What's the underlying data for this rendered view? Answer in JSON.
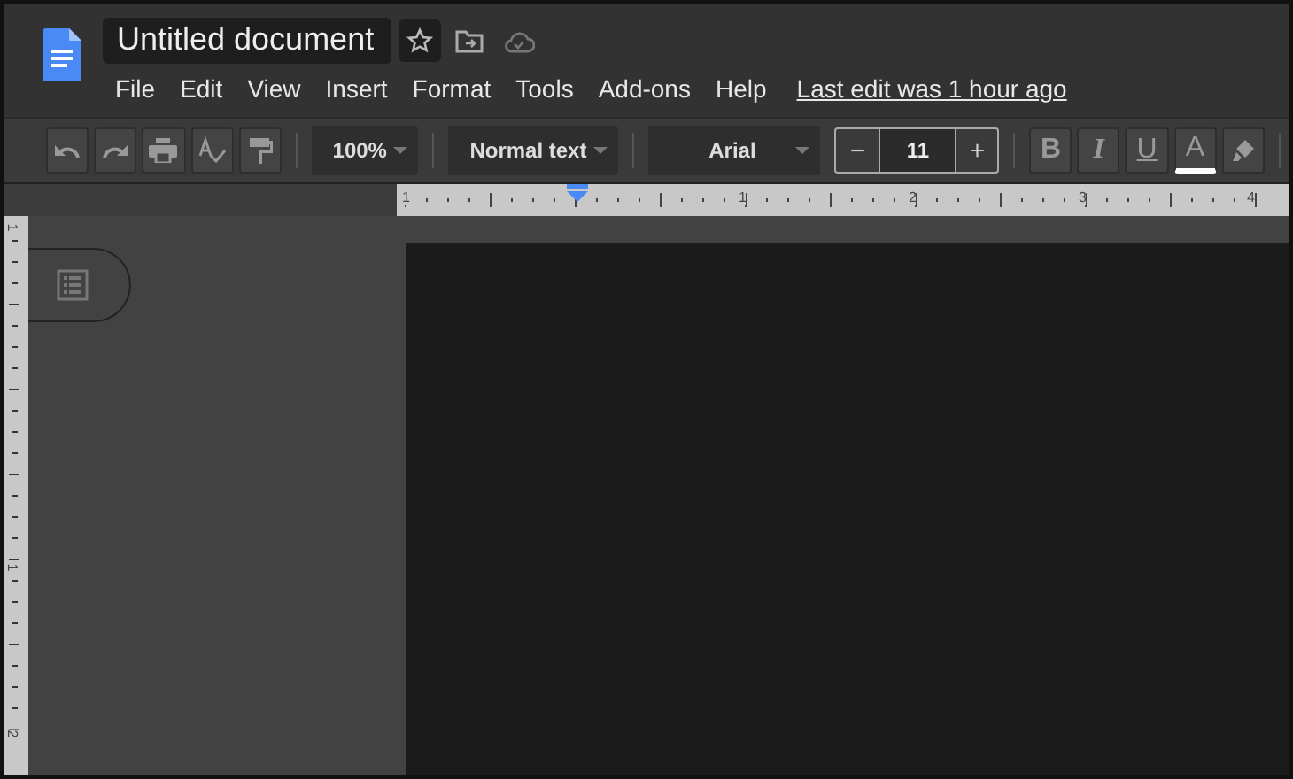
{
  "title": "Untitled document",
  "menus": [
    "File",
    "Edit",
    "View",
    "Insert",
    "Format",
    "Tools",
    "Add-ons",
    "Help"
  ],
  "last_edit": "Last edit was 1 hour ago",
  "toolbar": {
    "zoom": "100%",
    "style": "Normal text",
    "font": "Arial",
    "font_size": {
      "minus": "−",
      "value": "11",
      "plus": "+"
    },
    "format_buttons": [
      {
        "label": "B",
        "kind": "bold"
      },
      {
        "label": "I",
        "kind": "italic"
      },
      {
        "label": "U",
        "kind": "underline"
      },
      {
        "label": "A",
        "kind": "color"
      }
    ]
  },
  "ruler": {
    "horizontal": [
      "1",
      "1",
      "2",
      "3",
      "4"
    ],
    "vertical": [
      "1",
      "1",
      "2"
    ]
  }
}
